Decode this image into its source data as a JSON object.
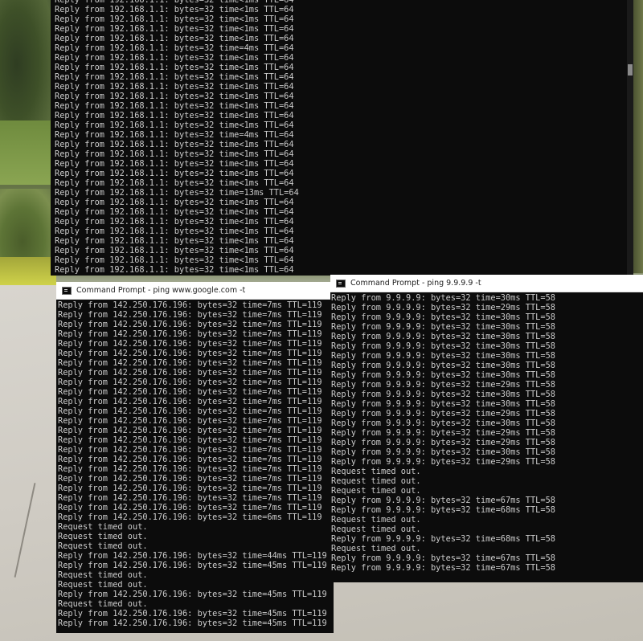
{
  "router_window": {
    "lines": [
      "Reply from 192.168.1.1: bytes=32 time<1ms TTL=64",
      "Reply from 192.168.1.1: bytes=32 time<1ms TTL=64",
      "Reply from 192.168.1.1: bytes=32 time<1ms TTL=64",
      "Reply from 192.168.1.1: bytes=32 time<1ms TTL=64",
      "Reply from 192.168.1.1: bytes=32 time<1ms TTL=64",
      "Reply from 192.168.1.1: bytes=32 time=4ms TTL=64",
      "Reply from 192.168.1.1: bytes=32 time<1ms TTL=64",
      "Reply from 192.168.1.1: bytes=32 time<1ms TTL=64",
      "Reply from 192.168.1.1: bytes=32 time<1ms TTL=64",
      "Reply from 192.168.1.1: bytes=32 time<1ms TTL=64",
      "Reply from 192.168.1.1: bytes=32 time<1ms TTL=64",
      "Reply from 192.168.1.1: bytes=32 time<1ms TTL=64",
      "Reply from 192.168.1.1: bytes=32 time<1ms TTL=64",
      "Reply from 192.168.1.1: bytes=32 time<1ms TTL=64",
      "Reply from 192.168.1.1: bytes=32 time=4ms TTL=64",
      "Reply from 192.168.1.1: bytes=32 time<1ms TTL=64",
      "Reply from 192.168.1.1: bytes=32 time<1ms TTL=64",
      "Reply from 192.168.1.1: bytes=32 time<1ms TTL=64",
      "Reply from 192.168.1.1: bytes=32 time<1ms TTL=64",
      "Reply from 192.168.1.1: bytes=32 time<1ms TTL=64",
      "Reply from 192.168.1.1: bytes=32 time=13ms TTL=64",
      "Reply from 192.168.1.1: bytes=32 time<1ms TTL=64",
      "Reply from 192.168.1.1: bytes=32 time<1ms TTL=64",
      "Reply from 192.168.1.1: bytes=32 time<1ms TTL=64",
      "Reply from 192.168.1.1: bytes=32 time<1ms TTL=64",
      "Reply from 192.168.1.1: bytes=32 time<1ms TTL=64",
      "Reply from 192.168.1.1: bytes=32 time<1ms TTL=64",
      "Reply from 192.168.1.1: bytes=32 time<1ms TTL=64",
      "Reply from 192.168.1.1: bytes=32 time<1ms TTL=64"
    ]
  },
  "google_window": {
    "title": "Command Prompt - ping  www.google.com -t",
    "lines": [
      "Reply from 142.250.176.196: bytes=32 time=7ms TTL=119",
      "Reply from 142.250.176.196: bytes=32 time=7ms TTL=119",
      "Reply from 142.250.176.196: bytes=32 time=7ms TTL=119",
      "Reply from 142.250.176.196: bytes=32 time=7ms TTL=119",
      "Reply from 142.250.176.196: bytes=32 time=7ms TTL=119",
      "Reply from 142.250.176.196: bytes=32 time=7ms TTL=119",
      "Reply from 142.250.176.196: bytes=32 time=7ms TTL=119",
      "Reply from 142.250.176.196: bytes=32 time=7ms TTL=119",
      "Reply from 142.250.176.196: bytes=32 time=7ms TTL=119",
      "Reply from 142.250.176.196: bytes=32 time=7ms TTL=119",
      "Reply from 142.250.176.196: bytes=32 time=7ms TTL=119",
      "Reply from 142.250.176.196: bytes=32 time=7ms TTL=119",
      "Reply from 142.250.176.196: bytes=32 time=7ms TTL=119",
      "Reply from 142.250.176.196: bytes=32 time=7ms TTL=119",
      "Reply from 142.250.176.196: bytes=32 time=7ms TTL=119",
      "Reply from 142.250.176.196: bytes=32 time=7ms TTL=119",
      "Reply from 142.250.176.196: bytes=32 time=7ms TTL=119",
      "Reply from 142.250.176.196: bytes=32 time=7ms TTL=119",
      "Reply from 142.250.176.196: bytes=32 time=7ms TTL=119",
      "Reply from 142.250.176.196: bytes=32 time=7ms TTL=119",
      "Reply from 142.250.176.196: bytes=32 time=7ms TTL=119",
      "Reply from 142.250.176.196: bytes=32 time=7ms TTL=119",
      "Reply from 142.250.176.196: bytes=32 time=6ms TTL=119",
      "Request timed out.",
      "Request timed out.",
      "Request timed out.",
      "Reply from 142.250.176.196: bytes=32 time=44ms TTL=119",
      "Reply from 142.250.176.196: bytes=32 time=45ms TTL=119",
      "Request timed out.",
      "Request timed out.",
      "Reply from 142.250.176.196: bytes=32 time=45ms TTL=119",
      "Request timed out.",
      "Reply from 142.250.176.196: bytes=32 time=45ms TTL=119",
      "Reply from 142.250.176.196: bytes=32 time=45ms TTL=119"
    ]
  },
  "quad9_window": {
    "title": "Command Prompt - ping  9.9.9.9 -t",
    "lines": [
      "Reply from 9.9.9.9: bytes=32 time=30ms TTL=58",
      "Reply from 9.9.9.9: bytes=32 time=29ms TTL=58",
      "Reply from 9.9.9.9: bytes=32 time=30ms TTL=58",
      "Reply from 9.9.9.9: bytes=32 time=30ms TTL=58",
      "Reply from 9.9.9.9: bytes=32 time=30ms TTL=58",
      "Reply from 9.9.9.9: bytes=32 time=30ms TTL=58",
      "Reply from 9.9.9.9: bytes=32 time=30ms TTL=58",
      "Reply from 9.9.9.9: bytes=32 time=30ms TTL=58",
      "Reply from 9.9.9.9: bytes=32 time=30ms TTL=58",
      "Reply from 9.9.9.9: bytes=32 time=29ms TTL=58",
      "Reply from 9.9.9.9: bytes=32 time=30ms TTL=58",
      "Reply from 9.9.9.9: bytes=32 time=30ms TTL=58",
      "Reply from 9.9.9.9: bytes=32 time=29ms TTL=58",
      "Reply from 9.9.9.9: bytes=32 time=30ms TTL=58",
      "Reply from 9.9.9.9: bytes=32 time=29ms TTL=58",
      "Reply from 9.9.9.9: bytes=32 time=29ms TTL=58",
      "Reply from 9.9.9.9: bytes=32 time=30ms TTL=58",
      "Reply from 9.9.9.9: bytes=32 time=29ms TTL=58",
      "Request timed out.",
      "Request timed out.",
      "Request timed out.",
      "Reply from 9.9.9.9: bytes=32 time=67ms TTL=58",
      "Reply from 9.9.9.9: bytes=32 time=68ms TTL=58",
      "Request timed out.",
      "Request timed out.",
      "Reply from 9.9.9.9: bytes=32 time=68ms TTL=58",
      "Request timed out.",
      "Reply from 9.9.9.9: bytes=32 time=67ms TTL=58",
      "Reply from 9.9.9.9: bytes=32 time=67ms TTL=58"
    ]
  },
  "colors": {
    "console_bg": "#0c0c0c",
    "console_fg": "#cccccc",
    "titlebar_bg": "#ffffff",
    "titlebar_fg": "#1e1e1e"
  },
  "icons": {
    "window_icon": "command-prompt-icon"
  }
}
